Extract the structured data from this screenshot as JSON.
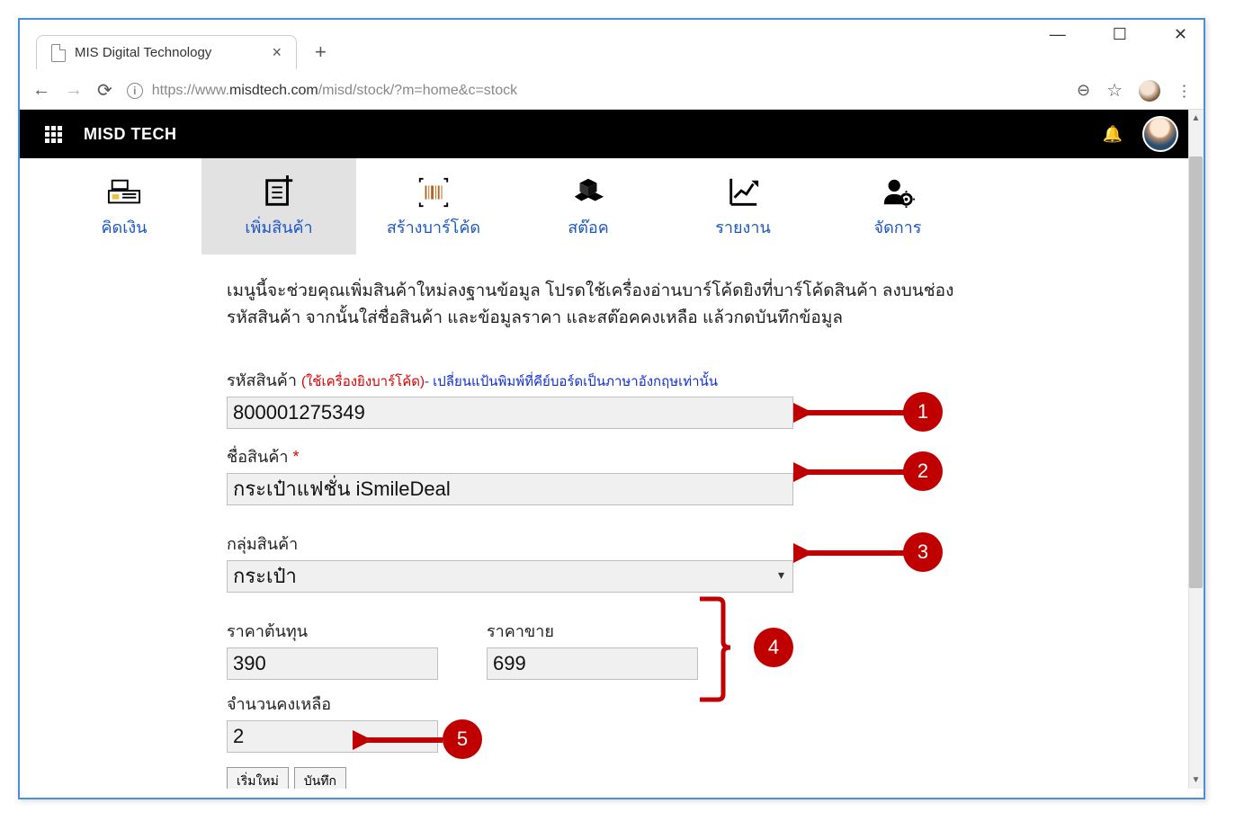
{
  "window": {
    "tab_title": "MIS Digital Technology",
    "url_prefix": "https://www.",
    "url_host": "misdtech.com",
    "url_path": "/misd/stock/?m=home&c=stock"
  },
  "header": {
    "brand": "MISD TECH"
  },
  "tabs": {
    "pos": "คิดเงิน",
    "add_product": "เพิ่มสินค้า",
    "barcode": "สร้างบาร์โค้ด",
    "stock": "สต๊อค",
    "report": "รายงาน",
    "manage": "จัดการ"
  },
  "intro": "เมนูนี้จะช่วยคุณเพิ่มสินค้าใหม่ลงฐานข้อมูล โปรดใช้เครื่องอ่านบาร์โค้ดยิงที่บาร์โค้ดสินค้า ลงบนช่องรหัสสินค้า จากนั้นใส่ชื่อสินค้า และข้อมูลราคา และสต๊อคคงเหลือ แล้วกดบันทึกข้อมูล",
  "form": {
    "code_label": "รหัสสินค้า",
    "code_hint_red": "(ใช้เครื่องยิงบาร์โค้ด)",
    "code_hint_blue": "- เปลี่ยนแป้นพิมพ์ที่คีย์บอร์ดเป็นภาษาอังกฤษเท่านั้น",
    "code_value": "800001275349",
    "name_label": "ชื่อสินค้า",
    "name_value": "กระเป๋าแฟชั่น iSmileDeal",
    "group_label": "กลุ่มสินค้า",
    "group_value": "กระเป๋า",
    "cost_label": "ราคาต้นทุน",
    "cost_value": "390",
    "price_label": "ราคาขาย",
    "price_value": "699",
    "qty_label": "จำนวนคงเหลือ",
    "qty_value": "2",
    "btn_reset": "เริ่มใหม่",
    "btn_save": "บันทึก"
  },
  "callouts": {
    "c1": "1",
    "c2": "2",
    "c3": "3",
    "c4": "4",
    "c5": "5"
  }
}
